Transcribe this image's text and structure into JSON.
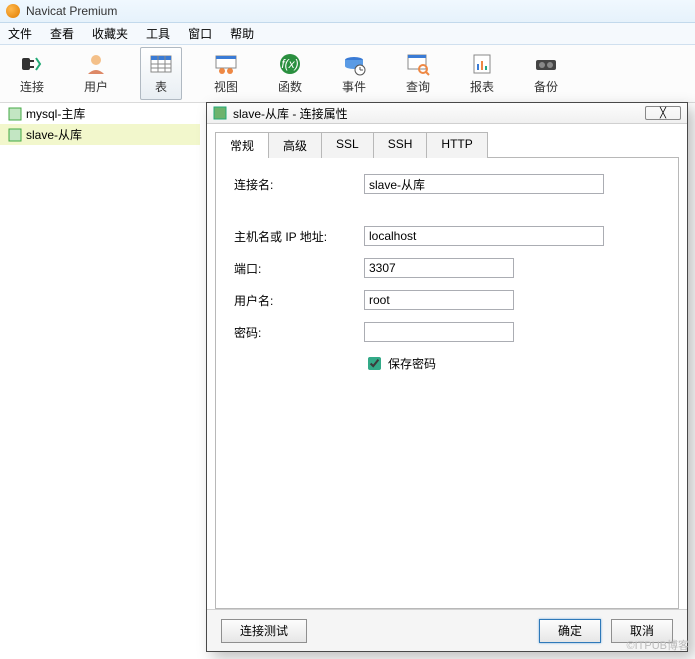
{
  "app": {
    "title": "Navicat Premium"
  },
  "menu": {
    "file": "文件",
    "view": "查看",
    "favorites": "收藏夹",
    "tools": "工具",
    "window": "窗口",
    "help": "帮助"
  },
  "toolbar": {
    "conn": "连接",
    "user": "用户",
    "table": "表",
    "view": "视图",
    "func": "函数",
    "event": "事件",
    "query": "查询",
    "report": "报表",
    "backup": "备份"
  },
  "tree": {
    "item1": "mysql-主库",
    "item2": "slave-从库"
  },
  "dialog": {
    "title": "slave-从库 - 连接属性",
    "tabs": {
      "general": "常规",
      "advanced": "高级",
      "ssl": "SSL",
      "ssh": "SSH",
      "http": "HTTP"
    },
    "labels": {
      "conn_name": "连接名:",
      "host": "主机名或 IP 地址:",
      "port": "端口:",
      "user": "用户名:",
      "pass": "密码:",
      "save_pass": "保存密码"
    },
    "values": {
      "conn_name": "slave-从库",
      "host": "localhost",
      "port": "3307",
      "user": "root",
      "pass": ""
    },
    "buttons": {
      "test": "连接测试",
      "ok": "确定",
      "cancel": "取消"
    }
  },
  "watermark": "©ITPUB博客"
}
